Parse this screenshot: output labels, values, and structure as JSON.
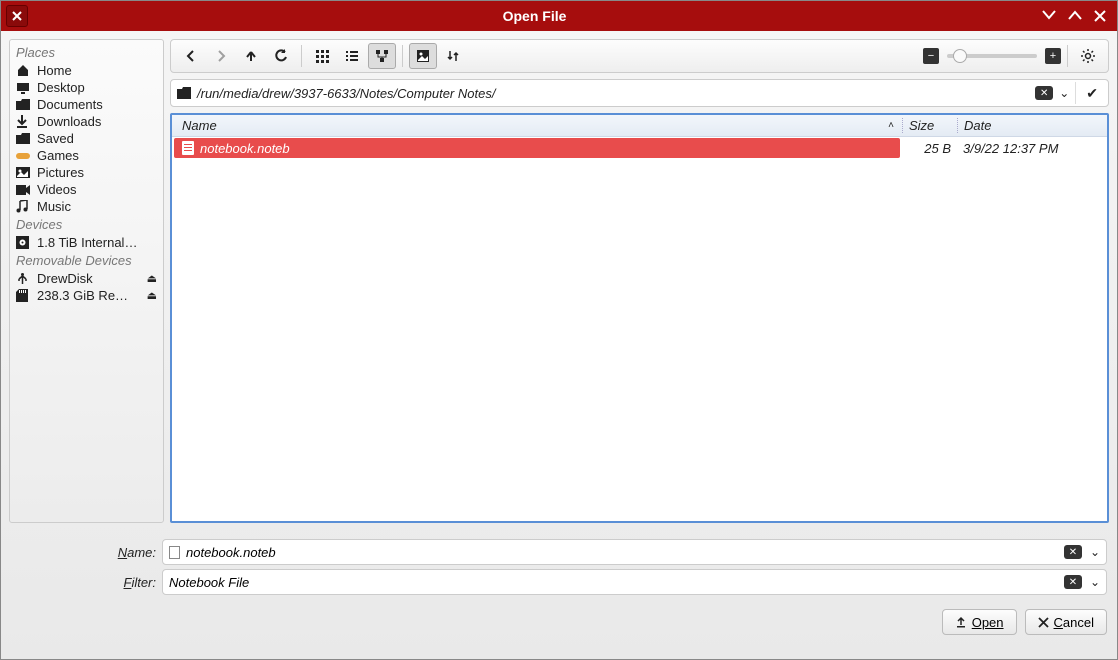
{
  "window": {
    "title": "Open File"
  },
  "sidebar": {
    "places_header": "Places",
    "places": [
      {
        "icon": "home",
        "label": "Home"
      },
      {
        "icon": "desktop",
        "label": "Desktop"
      },
      {
        "icon": "folder",
        "label": "Documents"
      },
      {
        "icon": "download",
        "label": "Downloads"
      },
      {
        "icon": "folder",
        "label": "Saved"
      },
      {
        "icon": "games",
        "label": "Games"
      },
      {
        "icon": "pictures",
        "label": "Pictures"
      },
      {
        "icon": "videos",
        "label": "Videos"
      },
      {
        "icon": "music",
        "label": "Music"
      }
    ],
    "devices_header": "Devices",
    "devices": [
      {
        "icon": "disk",
        "label": "1.8 TiB Internal…"
      }
    ],
    "removable_header": "Removable Devices",
    "removable": [
      {
        "icon": "usb",
        "label": "DrewDisk",
        "eject": true
      },
      {
        "icon": "sd",
        "label": "238.3 GiB Re…",
        "eject": true
      }
    ]
  },
  "path": "/run/media/drew/3937-6633/Notes/Computer Notes/",
  "columns": {
    "name": "Name",
    "size": "Size",
    "date": "Date"
  },
  "files": [
    {
      "name": "notebook.noteb",
      "size": "25 B",
      "date": "3/9/22 12:37 PM",
      "selected": true
    }
  ],
  "form": {
    "name_label": "Name:",
    "name_value": "notebook.noteb",
    "filter_label": "Filter:",
    "filter_value": "Notebook File"
  },
  "buttons": {
    "open": "Open",
    "cancel": "Cancel"
  }
}
